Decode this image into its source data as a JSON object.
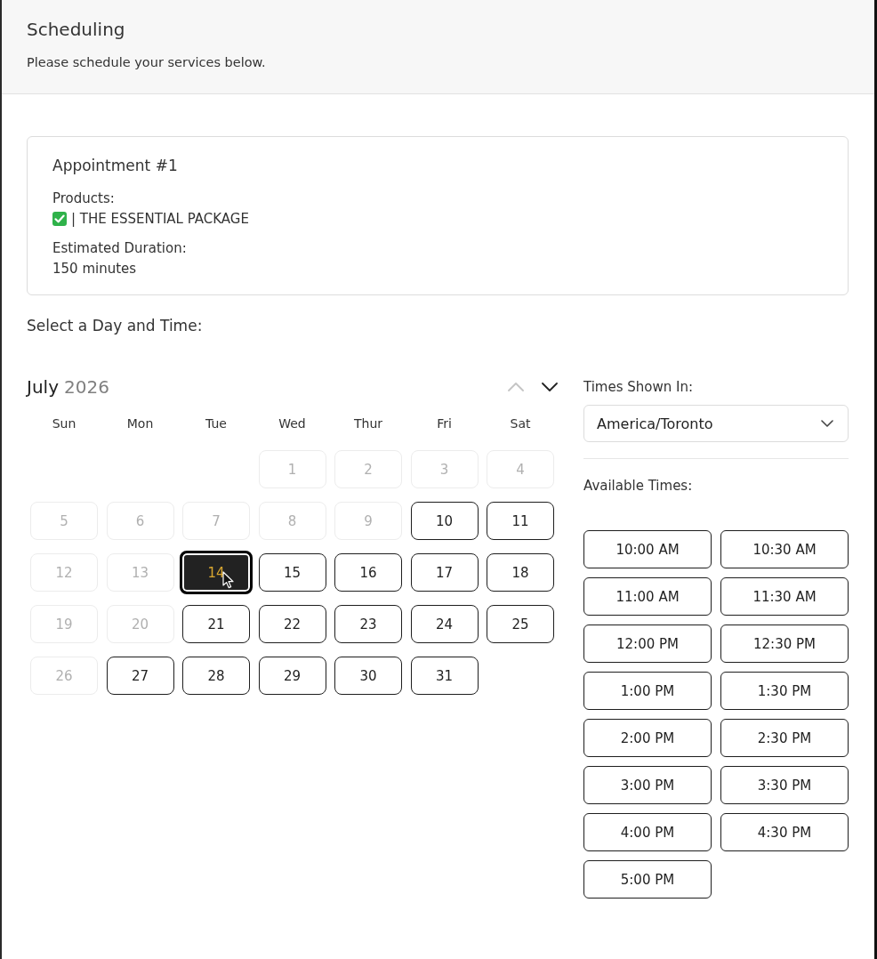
{
  "header": {
    "title": "Scheduling",
    "subtitle": "Please schedule your services below."
  },
  "appointment": {
    "title": "Appointment #1",
    "products_label": "Products:",
    "product": "| THE ESSENTIAL PACKAGE",
    "duration_label": "Estimated Duration:",
    "duration": "150 minutes"
  },
  "prompt": "Select a Day and Time:",
  "calendar": {
    "month": "July",
    "year": "2026",
    "prev": {
      "disabled": true
    },
    "next": {
      "disabled": false
    },
    "weekdays": [
      "Sun",
      "Mon",
      "Tue",
      "Wed",
      "Thur",
      "Fri",
      "Sat"
    ],
    "weeks": [
      {
        "days": [
          {
            "label": "1",
            "disabled": true,
            "selected": false
          },
          {
            "label": "2",
            "disabled": true,
            "selected": false
          },
          {
            "label": "3",
            "disabled": true,
            "selected": false
          },
          {
            "label": "4",
            "disabled": true,
            "selected": false
          }
        ]
      },
      {
        "days": [
          {
            "label": "5",
            "disabled": true,
            "selected": false
          },
          {
            "label": "6",
            "disabled": true,
            "selected": false
          },
          {
            "label": "7",
            "disabled": true,
            "selected": false
          },
          {
            "label": "8",
            "disabled": true,
            "selected": false
          },
          {
            "label": "9",
            "disabled": true,
            "selected": false
          },
          {
            "label": "10",
            "disabled": false,
            "selected": false
          },
          {
            "label": "11",
            "disabled": false,
            "selected": false
          }
        ]
      },
      {
        "days": [
          {
            "label": "12",
            "disabled": true,
            "selected": false
          },
          {
            "label": "13",
            "disabled": true,
            "selected": false
          },
          {
            "label": "14",
            "disabled": false,
            "selected": true
          },
          {
            "label": "15",
            "disabled": false,
            "selected": false
          },
          {
            "label": "16",
            "disabled": false,
            "selected": false
          },
          {
            "label": "17",
            "disabled": false,
            "selected": false
          },
          {
            "label": "18",
            "disabled": false,
            "selected": false
          }
        ]
      },
      {
        "days": [
          {
            "label": "19",
            "disabled": true,
            "selected": false
          },
          {
            "label": "20",
            "disabled": true,
            "selected": false
          },
          {
            "label": "21",
            "disabled": false,
            "selected": false
          },
          {
            "label": "22",
            "disabled": false,
            "selected": false
          },
          {
            "label": "23",
            "disabled": false,
            "selected": false
          },
          {
            "label": "24",
            "disabled": false,
            "selected": false
          },
          {
            "label": "25",
            "disabled": false,
            "selected": false
          }
        ]
      },
      {
        "days": [
          {
            "label": "26",
            "disabled": true,
            "selected": false
          },
          {
            "label": "27",
            "disabled": false,
            "selected": false
          },
          {
            "label": "28",
            "disabled": false,
            "selected": false
          },
          {
            "label": "29",
            "disabled": false,
            "selected": false
          },
          {
            "label": "30",
            "disabled": false,
            "selected": false
          },
          {
            "label": "31",
            "disabled": false,
            "selected": false
          }
        ]
      }
    ]
  },
  "timezone": {
    "label": "Times Shown In:",
    "value": "America/Toronto"
  },
  "times": {
    "label": "Available Times:",
    "slots": [
      {
        "label": "10:00 AM",
        "selected": false
      },
      {
        "label": "10:30 AM",
        "selected": false
      },
      {
        "label": "11:00 AM",
        "selected": false
      },
      {
        "label": "11:30 AM",
        "selected": false
      },
      {
        "label": "12:00 PM",
        "selected": false
      },
      {
        "label": "12:30 PM",
        "selected": false
      },
      {
        "label": "1:00 PM",
        "selected": false
      },
      {
        "label": "1:30 PM",
        "selected": false
      },
      {
        "label": "2:00 PM",
        "selected": false
      },
      {
        "label": "2:30 PM",
        "selected": false
      },
      {
        "label": "3:00 PM",
        "selected": false
      },
      {
        "label": "3:30 PM",
        "selected": false
      },
      {
        "label": "4:00 PM",
        "selected": false
      },
      {
        "label": "4:30 PM",
        "selected": false
      },
      {
        "label": "5:00 PM",
        "selected": false
      }
    ]
  }
}
